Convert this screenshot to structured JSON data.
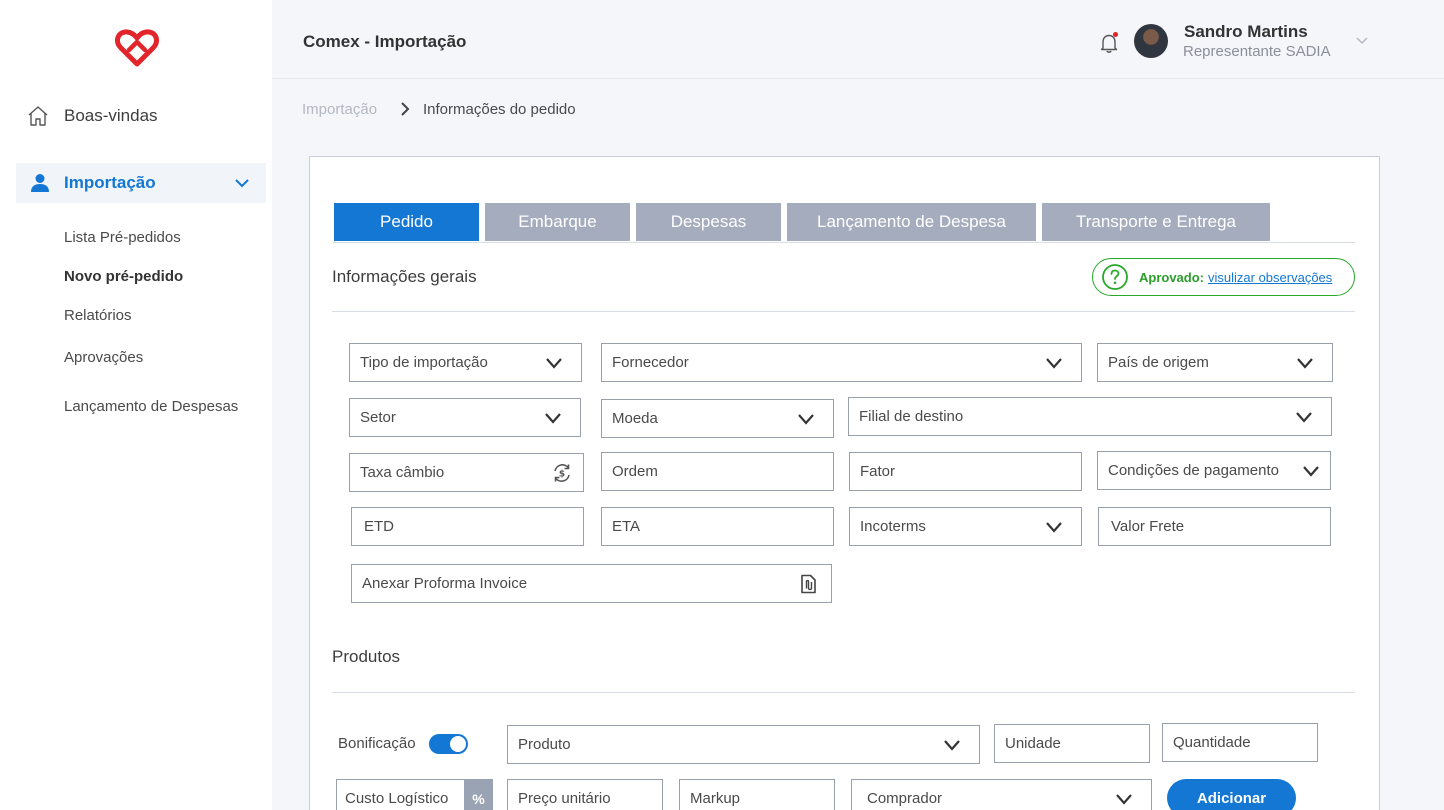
{
  "app": {
    "title": "Comex - Importação"
  },
  "sidebar": {
    "home_label": "Boas-vindas",
    "import_label": "Importação",
    "subitems": [
      "Lista Pré-pedidos",
      "Novo pré-pedido",
      "Relatórios",
      "Aprovações",
      "Lançamento de Despesas"
    ]
  },
  "user": {
    "name": "Sandro Martins",
    "role": "Representante SADIA"
  },
  "breadcrumb": {
    "parent": "Importação",
    "current": "Informações do pedido"
  },
  "tabs": [
    "Pedido",
    "Embarque",
    "Despesas",
    "Lançamento de Despesa",
    "Transporte e Entrega"
  ],
  "active_tab": "Pedido",
  "general": {
    "title": "Informações gerais",
    "status_label": "Aprovado:",
    "status_link": "visulizar observações",
    "fields": {
      "tipo": "Tipo de importação",
      "fornecedor": "Fornecedor",
      "pais": "País de origem",
      "setor": "Setor",
      "moeda": "Moeda",
      "filial": "Filial de destino",
      "taxa": "Taxa câmbio",
      "ordem": "Ordem",
      "fator": "Fator",
      "condicoes": "Condições de pagamento",
      "etd": "ETD",
      "eta": "ETA",
      "incoterms": "Incoterms",
      "frete": "Valor Frete",
      "proforma": "Anexar Proforma Invoice"
    }
  },
  "products": {
    "title": "Produtos",
    "bonificacao": "Bonificação",
    "bonificacao_on": true,
    "fields": {
      "produto": "Produto",
      "unidade": "Unidade",
      "quantidade": "Quantidade",
      "custo": "Custo Logístico",
      "percent": "%",
      "preco": "Preço unitário",
      "markup": "Markup",
      "comprador": "Comprador"
    },
    "add_label": "Adicionar"
  },
  "colors": {
    "primary": "#1477d4",
    "tab_inactive": "#a4acbd",
    "approved": "#2aa82a",
    "logo": "#e3242b"
  }
}
